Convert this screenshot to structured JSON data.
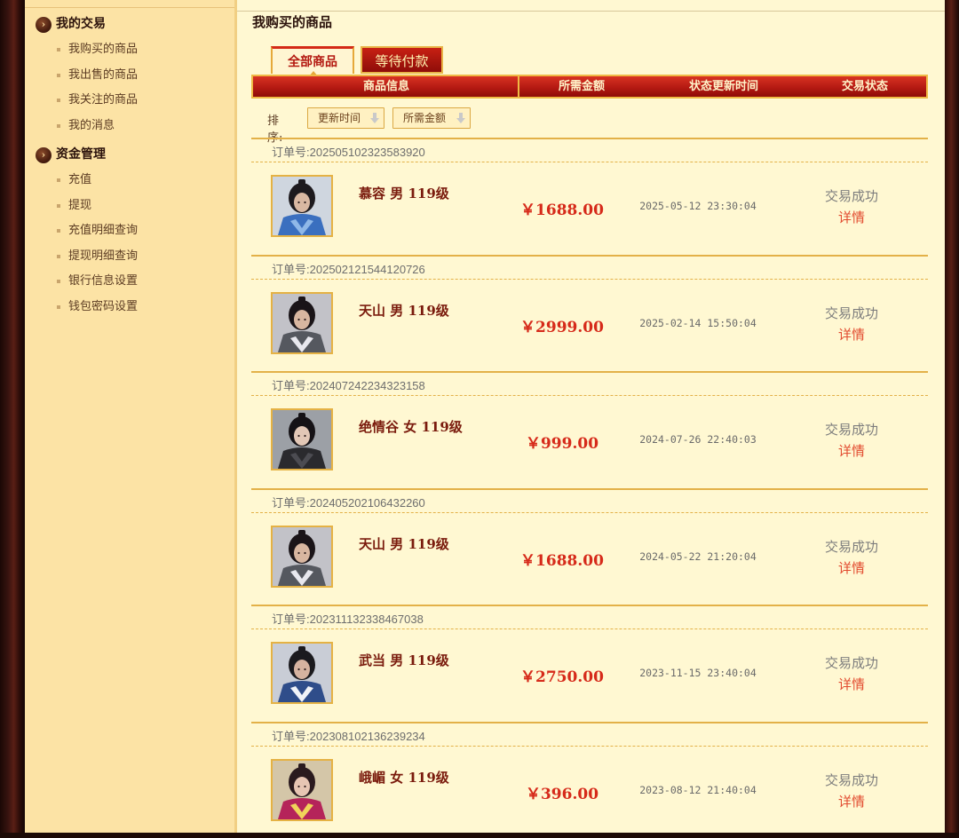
{
  "sidebar": {
    "sections": [
      {
        "title": "我的交易",
        "items": [
          "我购买的商品",
          "我出售的商品",
          "我关注的商品",
          "我的消息"
        ]
      },
      {
        "title": "资金管理",
        "items": [
          "充值",
          "提现",
          "充值明细查询",
          "提现明细查询",
          "银行信息设置",
          "钱包密码设置"
        ]
      }
    ]
  },
  "main": {
    "title": "我购买的商品",
    "tabs": [
      {
        "label": "全部商品",
        "active": true
      },
      {
        "label": "等待付款",
        "active": false
      }
    ],
    "table_headers": [
      "商品信息",
      "所需金额",
      "状态更新时间",
      "交易状态"
    ],
    "sort": {
      "label": "排序:",
      "buttons": [
        "更新时间",
        "所需金额"
      ]
    },
    "order_label": "订单号:",
    "orders": [
      {
        "order_no": "202505102323583920",
        "name": "慕容  男  119级",
        "price": "￥1688.00",
        "time": "2025-05-12 23:30:04",
        "status": "交易成功",
        "detail": "详情",
        "avatar": "portrait-blue"
      },
      {
        "order_no": "202502121544120726",
        "name": "天山  男  119级",
        "price": "￥2999.00",
        "time": "2025-02-14 15:50:04",
        "status": "交易成功",
        "detail": "详情",
        "avatar": "portrait-silver"
      },
      {
        "order_no": "202407242234323158",
        "name": "绝情谷  女  119级",
        "price": "￥999.00",
        "time": "2024-07-26 22:40:03",
        "status": "交易成功",
        "detail": "详情",
        "avatar": "portrait-dark"
      },
      {
        "order_no": "202405202106432260",
        "name": "天山  男  119级",
        "price": "￥1688.00",
        "time": "2024-05-22 21:20:04",
        "status": "交易成功",
        "detail": "详情",
        "avatar": "portrait-silver"
      },
      {
        "order_no": "202311132338467038",
        "name": "武当  男  119级",
        "price": "￥2750.00",
        "time": "2023-11-15 23:40:04",
        "status": "交易成功",
        "detail": "详情",
        "avatar": "portrait-white"
      },
      {
        "order_no": "202308102136239234",
        "name": "峨嵋  女  119级",
        "price": "￥396.00",
        "time": "2023-08-12 21:40:04",
        "status": "交易成功",
        "detail": "详情",
        "avatar": "portrait-pink"
      }
    ]
  },
  "colors": {
    "sidebar_bg": "#fce3a5",
    "main_bg": "#fff8d2",
    "header_red": "#b11811",
    "gold_border": "#e3b148",
    "price_red": "#d62a1a",
    "detail_red": "#e24a2e"
  }
}
